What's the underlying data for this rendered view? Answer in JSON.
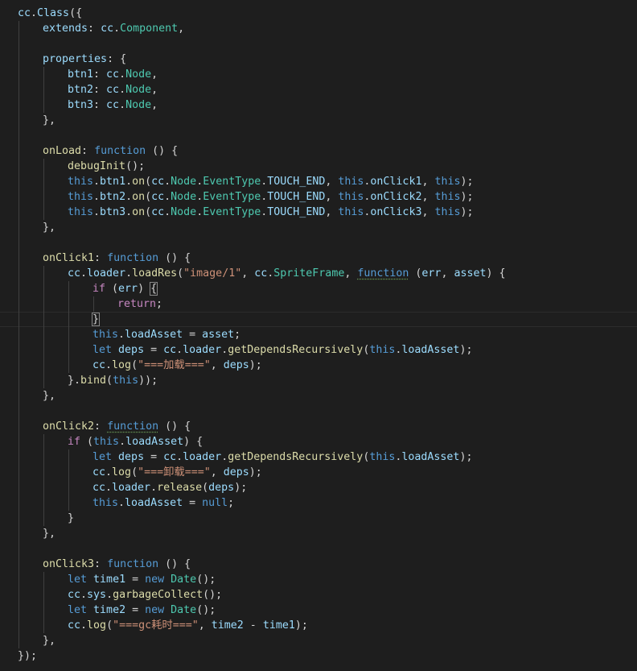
{
  "lines": [
    {
      "indent": 0,
      "tokens": [
        [
          "cc",
          "prop"
        ],
        [
          ".",
          "punct"
        ],
        [
          "Class",
          "prop"
        ],
        [
          "({",
          "punct"
        ]
      ]
    },
    {
      "indent": 1,
      "tokens": [
        [
          "extends",
          "prop"
        ],
        [
          ": ",
          "punct"
        ],
        [
          "cc",
          "prop"
        ],
        [
          ".",
          "punct"
        ],
        [
          "Component",
          "class"
        ],
        [
          ",",
          "punct"
        ]
      ]
    },
    {
      "indent": 1,
      "tokens": []
    },
    {
      "indent": 1,
      "tokens": [
        [
          "properties",
          "prop"
        ],
        [
          ": {",
          "punct"
        ]
      ]
    },
    {
      "indent": 2,
      "tokens": [
        [
          "btn1",
          "prop"
        ],
        [
          ": ",
          "punct"
        ],
        [
          "cc",
          "prop"
        ],
        [
          ".",
          "punct"
        ],
        [
          "Node",
          "class"
        ],
        [
          ",",
          "punct"
        ]
      ]
    },
    {
      "indent": 2,
      "tokens": [
        [
          "btn2",
          "prop"
        ],
        [
          ": ",
          "punct"
        ],
        [
          "cc",
          "prop"
        ],
        [
          ".",
          "punct"
        ],
        [
          "Node",
          "class"
        ],
        [
          ",",
          "punct"
        ]
      ]
    },
    {
      "indent": 2,
      "tokens": [
        [
          "btn3",
          "prop"
        ],
        [
          ": ",
          "punct"
        ],
        [
          "cc",
          "prop"
        ],
        [
          ".",
          "punct"
        ],
        [
          "Node",
          "class"
        ],
        [
          ",",
          "punct"
        ]
      ]
    },
    {
      "indent": 1,
      "tokens": [
        [
          "},",
          "punct"
        ]
      ]
    },
    {
      "indent": 1,
      "tokens": []
    },
    {
      "indent": 1,
      "tokens": [
        [
          "onLoad",
          "func"
        ],
        [
          ": ",
          "punct"
        ],
        [
          "function",
          "keyword"
        ],
        [
          " () {",
          "punct"
        ]
      ]
    },
    {
      "indent": 2,
      "tokens": [
        [
          "debugInit",
          "func"
        ],
        [
          "();",
          "punct"
        ]
      ]
    },
    {
      "indent": 2,
      "tokens": [
        [
          "this",
          "keyword"
        ],
        [
          ".",
          "punct"
        ],
        [
          "btn1",
          "prop"
        ],
        [
          ".",
          "punct"
        ],
        [
          "on",
          "func"
        ],
        [
          "(",
          "punct"
        ],
        [
          "cc",
          "prop"
        ],
        [
          ".",
          "punct"
        ],
        [
          "Node",
          "class"
        ],
        [
          ".",
          "punct"
        ],
        [
          "EventType",
          "class"
        ],
        [
          ".",
          "punct"
        ],
        [
          "TOUCH_END",
          "prop"
        ],
        [
          ", ",
          "punct"
        ],
        [
          "this",
          "keyword"
        ],
        [
          ".",
          "punct"
        ],
        [
          "onClick1",
          "prop"
        ],
        [
          ", ",
          "punct"
        ],
        [
          "this",
          "keyword"
        ],
        [
          ");",
          "punct"
        ]
      ]
    },
    {
      "indent": 2,
      "tokens": [
        [
          "this",
          "keyword"
        ],
        [
          ".",
          "punct"
        ],
        [
          "btn2",
          "prop"
        ],
        [
          ".",
          "punct"
        ],
        [
          "on",
          "func"
        ],
        [
          "(",
          "punct"
        ],
        [
          "cc",
          "prop"
        ],
        [
          ".",
          "punct"
        ],
        [
          "Node",
          "class"
        ],
        [
          ".",
          "punct"
        ],
        [
          "EventType",
          "class"
        ],
        [
          ".",
          "punct"
        ],
        [
          "TOUCH_END",
          "prop"
        ],
        [
          ", ",
          "punct"
        ],
        [
          "this",
          "keyword"
        ],
        [
          ".",
          "punct"
        ],
        [
          "onClick2",
          "prop"
        ],
        [
          ", ",
          "punct"
        ],
        [
          "this",
          "keyword"
        ],
        [
          ");",
          "punct"
        ]
      ]
    },
    {
      "indent": 2,
      "tokens": [
        [
          "this",
          "keyword"
        ],
        [
          ".",
          "punct"
        ],
        [
          "btn3",
          "prop"
        ],
        [
          ".",
          "punct"
        ],
        [
          "on",
          "func"
        ],
        [
          "(",
          "punct"
        ],
        [
          "cc",
          "prop"
        ],
        [
          ".",
          "punct"
        ],
        [
          "Node",
          "class"
        ],
        [
          ".",
          "punct"
        ],
        [
          "EventType",
          "class"
        ],
        [
          ".",
          "punct"
        ],
        [
          "TOUCH_END",
          "prop"
        ],
        [
          ", ",
          "punct"
        ],
        [
          "this",
          "keyword"
        ],
        [
          ".",
          "punct"
        ],
        [
          "onClick3",
          "prop"
        ],
        [
          ", ",
          "punct"
        ],
        [
          "this",
          "keyword"
        ],
        [
          ");",
          "punct"
        ]
      ]
    },
    {
      "indent": 1,
      "tokens": [
        [
          "},",
          "punct"
        ]
      ]
    },
    {
      "indent": 1,
      "tokens": []
    },
    {
      "indent": 1,
      "tokens": [
        [
          "onClick1",
          "func"
        ],
        [
          ": ",
          "punct"
        ],
        [
          "function",
          "keyword"
        ],
        [
          " () {",
          "punct"
        ]
      ]
    },
    {
      "indent": 2,
      "tokens": [
        [
          "cc",
          "prop"
        ],
        [
          ".",
          "punct"
        ],
        [
          "loader",
          "prop"
        ],
        [
          ".",
          "punct"
        ],
        [
          "loadRes",
          "func"
        ],
        [
          "(",
          "punct"
        ],
        [
          "\"image/1\"",
          "string"
        ],
        [
          ", ",
          "punct"
        ],
        [
          "cc",
          "prop"
        ],
        [
          ".",
          "punct"
        ],
        [
          "SpriteFrame",
          "class"
        ],
        [
          ", ",
          "punct"
        ],
        [
          "function",
          "keyword",
          "squig"
        ],
        [
          " (",
          "punct"
        ],
        [
          "err",
          "prop"
        ],
        [
          ", ",
          "punct"
        ],
        [
          "asset",
          "prop"
        ],
        [
          ") {",
          "punct"
        ]
      ]
    },
    {
      "indent": 3,
      "tokens": [
        [
          "if",
          "control"
        ],
        [
          " (",
          "punct"
        ],
        [
          "err",
          "prop"
        ],
        [
          ") ",
          "punct"
        ],
        [
          "{",
          "punct",
          "bracket"
        ]
      ]
    },
    {
      "indent": 4,
      "tokens": [
        [
          "return",
          "control"
        ],
        [
          ";",
          "punct"
        ]
      ]
    },
    {
      "indent": 3,
      "current": true,
      "tokens": [
        [
          "}",
          "punct",
          "bracket"
        ]
      ]
    },
    {
      "indent": 3,
      "tokens": [
        [
          "this",
          "keyword"
        ],
        [
          ".",
          "punct"
        ],
        [
          "loadAsset",
          "prop"
        ],
        [
          " = ",
          "punct"
        ],
        [
          "asset",
          "prop"
        ],
        [
          ";",
          "punct"
        ]
      ]
    },
    {
      "indent": 3,
      "tokens": [
        [
          "let",
          "keyword"
        ],
        [
          " ",
          "punct"
        ],
        [
          "deps",
          "prop"
        ],
        [
          " = ",
          "punct"
        ],
        [
          "cc",
          "prop"
        ],
        [
          ".",
          "punct"
        ],
        [
          "loader",
          "prop"
        ],
        [
          ".",
          "punct"
        ],
        [
          "getDependsRecursively",
          "func"
        ],
        [
          "(",
          "punct"
        ],
        [
          "this",
          "keyword"
        ],
        [
          ".",
          "punct"
        ],
        [
          "loadAsset",
          "prop"
        ],
        [
          ");",
          "punct"
        ]
      ]
    },
    {
      "indent": 3,
      "tokens": [
        [
          "cc",
          "prop"
        ],
        [
          ".",
          "punct"
        ],
        [
          "log",
          "func"
        ],
        [
          "(",
          "punct"
        ],
        [
          "\"===加载===\"",
          "string"
        ],
        [
          ", ",
          "punct"
        ],
        [
          "deps",
          "prop"
        ],
        [
          ");",
          "punct"
        ]
      ]
    },
    {
      "indent": 2,
      "tokens": [
        [
          "}.",
          "punct"
        ],
        [
          "bind",
          "func"
        ],
        [
          "(",
          "punct"
        ],
        [
          "this",
          "keyword"
        ],
        [
          "));",
          "punct"
        ]
      ]
    },
    {
      "indent": 1,
      "tokens": [
        [
          "},",
          "punct"
        ]
      ]
    },
    {
      "indent": 1,
      "tokens": []
    },
    {
      "indent": 1,
      "tokens": [
        [
          "onClick2",
          "func"
        ],
        [
          ": ",
          "punct"
        ],
        [
          "function",
          "keyword",
          "squig"
        ],
        [
          " () {",
          "punct"
        ]
      ]
    },
    {
      "indent": 2,
      "tokens": [
        [
          "if",
          "control"
        ],
        [
          " (",
          "punct"
        ],
        [
          "this",
          "keyword"
        ],
        [
          ".",
          "punct"
        ],
        [
          "loadAsset",
          "prop"
        ],
        [
          ") {",
          "punct"
        ]
      ]
    },
    {
      "indent": 3,
      "tokens": [
        [
          "let",
          "keyword"
        ],
        [
          " ",
          "punct"
        ],
        [
          "deps",
          "prop"
        ],
        [
          " = ",
          "punct"
        ],
        [
          "cc",
          "prop"
        ],
        [
          ".",
          "punct"
        ],
        [
          "loader",
          "prop"
        ],
        [
          ".",
          "punct"
        ],
        [
          "getDependsRecursively",
          "func"
        ],
        [
          "(",
          "punct"
        ],
        [
          "this",
          "keyword"
        ],
        [
          ".",
          "punct"
        ],
        [
          "loadAsset",
          "prop"
        ],
        [
          ");",
          "punct"
        ]
      ]
    },
    {
      "indent": 3,
      "tokens": [
        [
          "cc",
          "prop"
        ],
        [
          ".",
          "punct"
        ],
        [
          "log",
          "func"
        ],
        [
          "(",
          "punct"
        ],
        [
          "\"===卸载===\"",
          "string"
        ],
        [
          ", ",
          "punct"
        ],
        [
          "deps",
          "prop"
        ],
        [
          ");",
          "punct"
        ]
      ]
    },
    {
      "indent": 3,
      "tokens": [
        [
          "cc",
          "prop"
        ],
        [
          ".",
          "punct"
        ],
        [
          "loader",
          "prop"
        ],
        [
          ".",
          "punct"
        ],
        [
          "release",
          "func"
        ],
        [
          "(",
          "punct"
        ],
        [
          "deps",
          "prop"
        ],
        [
          ");",
          "punct"
        ]
      ]
    },
    {
      "indent": 3,
      "tokens": [
        [
          "this",
          "keyword"
        ],
        [
          ".",
          "punct"
        ],
        [
          "loadAsset",
          "prop"
        ],
        [
          " = ",
          "punct"
        ],
        [
          "null",
          "keyword"
        ],
        [
          ";",
          "punct"
        ]
      ]
    },
    {
      "indent": 2,
      "tokens": [
        [
          "}",
          "punct"
        ]
      ]
    },
    {
      "indent": 1,
      "tokens": [
        [
          "},",
          "punct"
        ]
      ]
    },
    {
      "indent": 1,
      "tokens": []
    },
    {
      "indent": 1,
      "tokens": [
        [
          "onClick3",
          "func"
        ],
        [
          ": ",
          "punct"
        ],
        [
          "function",
          "keyword"
        ],
        [
          " () {",
          "punct"
        ]
      ]
    },
    {
      "indent": 2,
      "tokens": [
        [
          "let",
          "keyword"
        ],
        [
          " ",
          "punct"
        ],
        [
          "time1",
          "prop"
        ],
        [
          " = ",
          "punct"
        ],
        [
          "new",
          "keyword"
        ],
        [
          " ",
          "punct"
        ],
        [
          "Date",
          "class"
        ],
        [
          "();",
          "punct"
        ]
      ]
    },
    {
      "indent": 2,
      "tokens": [
        [
          "cc",
          "prop"
        ],
        [
          ".",
          "punct"
        ],
        [
          "sys",
          "prop"
        ],
        [
          ".",
          "punct"
        ],
        [
          "garbageCollect",
          "func"
        ],
        [
          "();",
          "punct"
        ]
      ]
    },
    {
      "indent": 2,
      "tokens": [
        [
          "let",
          "keyword"
        ],
        [
          " ",
          "punct"
        ],
        [
          "time2",
          "prop"
        ],
        [
          " = ",
          "punct"
        ],
        [
          "new",
          "keyword"
        ],
        [
          " ",
          "punct"
        ],
        [
          "Date",
          "class"
        ],
        [
          "();",
          "punct"
        ]
      ]
    },
    {
      "indent": 2,
      "tokens": [
        [
          "cc",
          "prop"
        ],
        [
          ".",
          "punct"
        ],
        [
          "log",
          "func"
        ],
        [
          "(",
          "punct"
        ],
        [
          "\"===gc耗时===\"",
          "string"
        ],
        [
          ", ",
          "punct"
        ],
        [
          "time2",
          "prop"
        ],
        [
          " - ",
          "punct"
        ],
        [
          "time1",
          "prop"
        ],
        [
          ");",
          "punct"
        ]
      ]
    },
    {
      "indent": 1,
      "tokens": [
        [
          "},",
          "punct"
        ]
      ]
    },
    {
      "indent": 0,
      "tokens": [
        [
          "});",
          "punct"
        ]
      ]
    }
  ]
}
